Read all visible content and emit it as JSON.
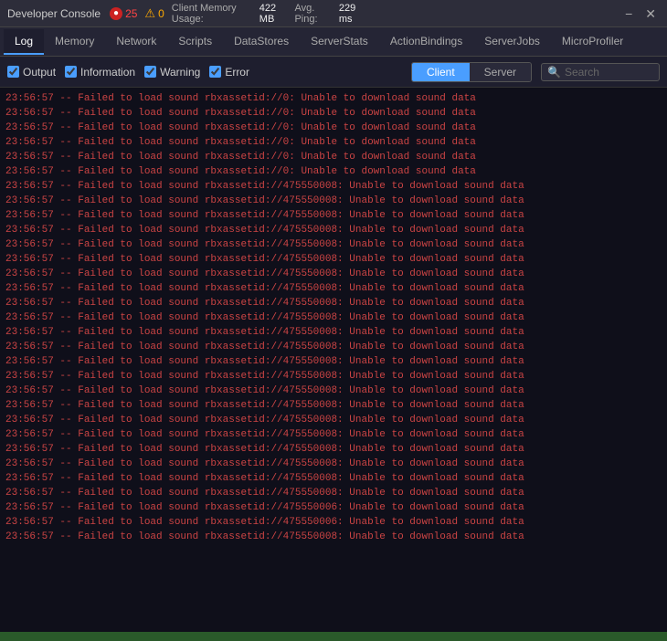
{
  "titleBar": {
    "title": "Developer Console",
    "errorCount": "25",
    "warnCount": "0",
    "memoryLabel": "Client Memory Usage:",
    "memoryValue": "422 MB",
    "pingLabel": "Avg. Ping:",
    "pingValue": "229 ms",
    "minimize": "−",
    "close": "✕"
  },
  "navTabs": [
    {
      "id": "log",
      "label": "Log",
      "active": true
    },
    {
      "id": "memory",
      "label": "Memory",
      "active": false
    },
    {
      "id": "network",
      "label": "Network",
      "active": false
    },
    {
      "id": "scripts",
      "label": "Scripts",
      "active": false
    },
    {
      "id": "datastores",
      "label": "DataStores",
      "active": false
    },
    {
      "id": "serverstats",
      "label": "ServerStats",
      "active": false
    },
    {
      "id": "actionbindings",
      "label": "ActionBindings",
      "active": false
    },
    {
      "id": "serverjobs",
      "label": "ServerJobs",
      "active": false
    },
    {
      "id": "microprofiler",
      "label": "MicroProfiler",
      "active": false
    }
  ],
  "filterBar": {
    "output": "Output",
    "information": "Information",
    "warning": "Warning",
    "error": "Error",
    "clientBtn": "Client",
    "serverBtn": "Server",
    "searchPlaceholder": "Search"
  },
  "logLines": [
    "23:56:57  --  Failed to load sound rbxassetid://0: Unable to download sound data",
    "23:56:57  --  Failed to load sound rbxassetid://0: Unable to download sound data",
    "23:56:57  --  Failed to load sound rbxassetid://0: Unable to download sound data",
    "23:56:57  --  Failed to load sound rbxassetid://0: Unable to download sound data",
    "23:56:57  --  Failed to load sound rbxassetid://0: Unable to download sound data",
    "23:56:57  --  Failed to load sound rbxassetid://0: Unable to download sound data",
    "23:56:57  --  Failed to load sound rbxassetid://475550008: Unable to download sound data",
    "23:56:57  --  Failed to load sound rbxassetid://475550008: Unable to download sound data",
    "23:56:57  --  Failed to load sound rbxassetid://475550008: Unable to download sound data",
    "23:56:57  --  Failed to load sound rbxassetid://475550008: Unable to download sound data",
    "23:56:57  --  Failed to load sound rbxassetid://475550008: Unable to download sound data",
    "23:56:57  --  Failed to load sound rbxassetid://475550008: Unable to download sound data",
    "23:56:57  --  Failed to load sound rbxassetid://475550008: Unable to download sound data",
    "23:56:57  --  Failed to load sound rbxassetid://475550008: Unable to download sound data",
    "23:56:57  --  Failed to load sound rbxassetid://475550008: Unable to download sound data",
    "23:56:57  --  Failed to load sound rbxassetid://475550008: Unable to download sound data",
    "23:56:57  --  Failed to load sound rbxassetid://475550008: Unable to download sound data",
    "23:56:57  --  Failed to load sound rbxassetid://475550008: Unable to download sound data",
    "23:56:57  --  Failed to load sound rbxassetid://475550008: Unable to download sound data",
    "23:56:57  --  Failed to load sound rbxassetid://475550008: Unable to download sound data",
    "23:56:57  --  Failed to load sound rbxassetid://475550008: Unable to download sound data",
    "23:56:57  --  Failed to load sound rbxassetid://475550008: Unable to download sound data",
    "23:56:57  --  Failed to load sound rbxassetid://475550008: Unable to download sound data",
    "23:56:57  --  Failed to load sound rbxassetid://475550008: Unable to download sound data",
    "23:56:57  --  Failed to load sound rbxassetid://475550008: Unable to download sound data",
    "23:56:57  --  Failed to load sound rbxassetid://475550008: Unable to download sound data",
    "23:56:57  --  Failed to load sound rbxassetid://475550008: Unable to download sound data",
    "23:56:57  --  Failed to load sound rbxassetid://475550008: Unable to download sound data",
    "23:56:57  --  Failed to load sound rbxassetid://475550006: Unable to download sound data",
    "23:56:57  --  Failed to load sound rbxassetid://475550006: Unable to download sound data",
    "23:56:57  --  Failed to load sound rbxassetid://475550008: Unable to download sound data"
  ]
}
